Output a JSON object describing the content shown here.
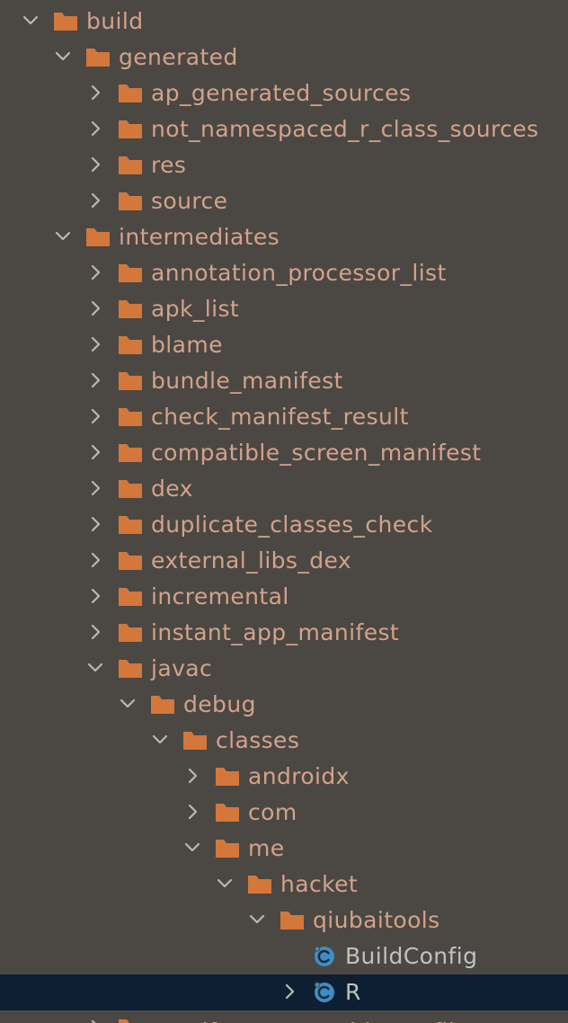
{
  "colors": {
    "background": "#4b4844",
    "selected_row": "#0f1f33",
    "folder_icon": "#d4773a",
    "folder_text": "#d4a28a",
    "file_text": "#c0c1c2",
    "class_icon": "#3f8dc6",
    "chevron": "#b9b8b6"
  },
  "tree": {
    "rows": [
      {
        "label": "build",
        "depth": 0,
        "kind": "folder",
        "expanded": true
      },
      {
        "label": "generated",
        "depth": 1,
        "kind": "folder",
        "expanded": true
      },
      {
        "label": "ap_generated_sources",
        "depth": 2,
        "kind": "folder",
        "expanded": false
      },
      {
        "label": "not_namespaced_r_class_sources",
        "depth": 2,
        "kind": "folder",
        "expanded": false
      },
      {
        "label": "res",
        "depth": 2,
        "kind": "folder",
        "expanded": false
      },
      {
        "label": "source",
        "depth": 2,
        "kind": "folder",
        "expanded": false
      },
      {
        "label": "intermediates",
        "depth": 1,
        "kind": "folder",
        "expanded": true
      },
      {
        "label": "annotation_processor_list",
        "depth": 2,
        "kind": "folder",
        "expanded": false
      },
      {
        "label": "apk_list",
        "depth": 2,
        "kind": "folder",
        "expanded": false
      },
      {
        "label": "blame",
        "depth": 2,
        "kind": "folder",
        "expanded": false
      },
      {
        "label": "bundle_manifest",
        "depth": 2,
        "kind": "folder",
        "expanded": false
      },
      {
        "label": "check_manifest_result",
        "depth": 2,
        "kind": "folder",
        "expanded": false
      },
      {
        "label": "compatible_screen_manifest",
        "depth": 2,
        "kind": "folder",
        "expanded": false
      },
      {
        "label": "dex",
        "depth": 2,
        "kind": "folder",
        "expanded": false
      },
      {
        "label": "duplicate_classes_check",
        "depth": 2,
        "kind": "folder",
        "expanded": false
      },
      {
        "label": "external_libs_dex",
        "depth": 2,
        "kind": "folder",
        "expanded": false
      },
      {
        "label": "incremental",
        "depth": 2,
        "kind": "folder",
        "expanded": false
      },
      {
        "label": "instant_app_manifest",
        "depth": 2,
        "kind": "folder",
        "expanded": false
      },
      {
        "label": "javac",
        "depth": 2,
        "kind": "folder",
        "expanded": true
      },
      {
        "label": "debug",
        "depth": 3,
        "kind": "folder",
        "expanded": true
      },
      {
        "label": "classes",
        "depth": 4,
        "kind": "folder",
        "expanded": true
      },
      {
        "label": "androidx",
        "depth": 5,
        "kind": "folder",
        "expanded": false
      },
      {
        "label": "com",
        "depth": 5,
        "kind": "folder",
        "expanded": false
      },
      {
        "label": "me",
        "depth": 5,
        "kind": "folder",
        "expanded": true
      },
      {
        "label": "hacket",
        "depth": 6,
        "kind": "folder",
        "expanded": true
      },
      {
        "label": "qiubaitools",
        "depth": 7,
        "kind": "folder",
        "expanded": true
      },
      {
        "label": "BuildConfig",
        "depth": 8,
        "kind": "class",
        "expanded": null
      },
      {
        "label": "R",
        "depth": 8,
        "kind": "class",
        "expanded": false,
        "selected": true
      },
      {
        "label": "manifest_merge_blame_file",
        "depth": 2,
        "kind": "folder",
        "expanded": false,
        "partial": true
      }
    ]
  }
}
